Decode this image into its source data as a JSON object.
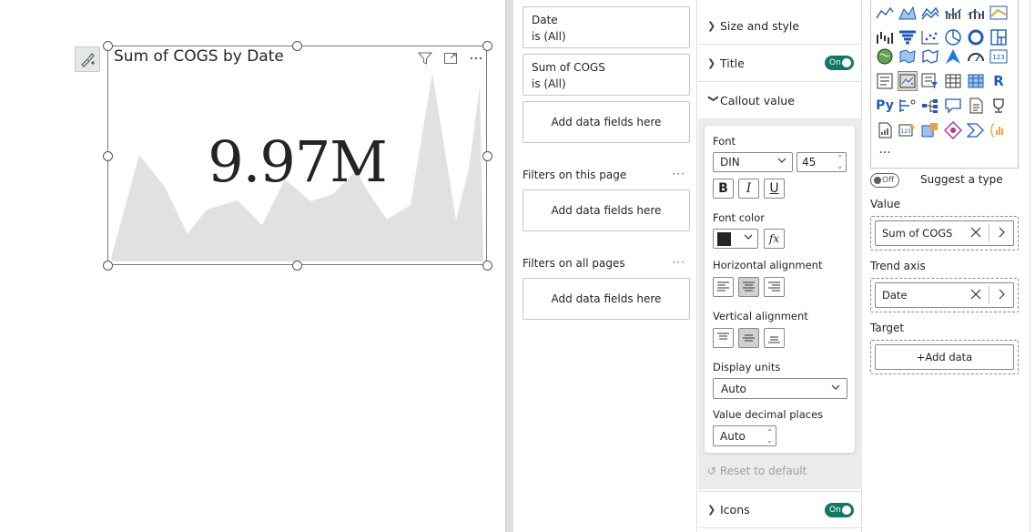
{
  "visual": {
    "title": "Sum of COGS by Date",
    "callout_value": "9.97M",
    "icons": [
      "format-brush-icon",
      "filter-icon",
      "focus-mode-icon",
      "more-options-icon"
    ],
    "sparkline_color": "#e1e1e1"
  },
  "filters": {
    "visual_filters": [
      {
        "field": "Date",
        "state": "is (All)"
      },
      {
        "field": "Sum of COGS",
        "state": "is (All)"
      }
    ],
    "add_fields_label": "Add data fields here",
    "page_section": "Filters on this page",
    "all_pages_section": "Filters on all pages",
    "more": "···"
  },
  "format": {
    "size_style": "Size and style",
    "title": "Title",
    "title_toggle": "On",
    "callout_value": "Callout value",
    "font_label": "Font",
    "font_family": "DIN",
    "font_size": "45",
    "bold": "B",
    "italic": "I",
    "underline": "U",
    "font_color_label": "Font color",
    "font_color": "#252423",
    "fx": "fx",
    "h_align_label": "Horizontal alignment",
    "v_align_label": "Vertical alignment",
    "display_units_label": "Display units",
    "display_units": "Auto",
    "decimal_label": "Value decimal places",
    "decimal_value": "Auto",
    "reset": "Reset to default",
    "icons": "Icons",
    "icons_toggle": "On",
    "accent": "#117865"
  },
  "visualizations": {
    "more": "···",
    "suggest_toggle": "Off",
    "suggest_label": "Suggest a type",
    "value_label": "Value",
    "value_field": "Sum of COGS",
    "trend_label": "Trend axis",
    "trend_field": "Date",
    "target_label": "Target",
    "add_data": "+Add data"
  }
}
